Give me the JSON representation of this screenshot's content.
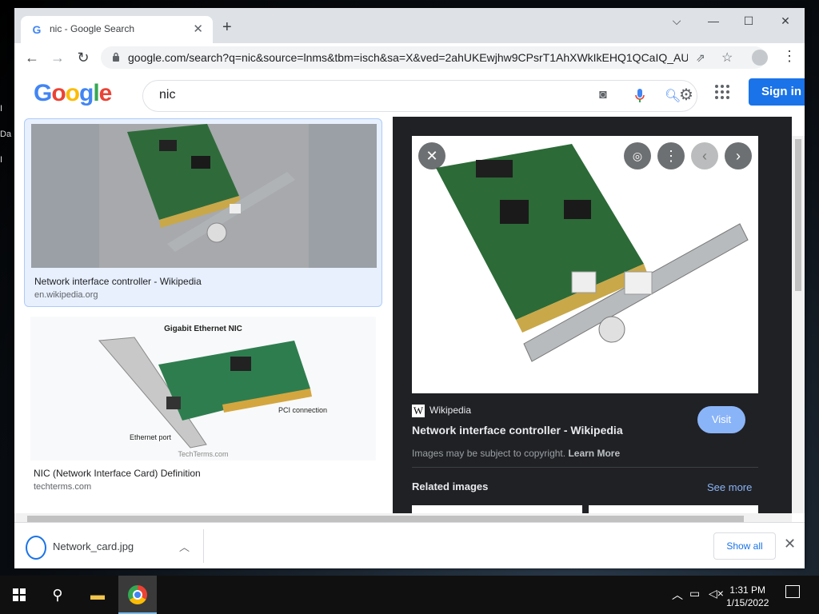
{
  "desktop": {
    "edge_labels": [
      "I",
      "Da",
      "I"
    ]
  },
  "browser": {
    "tab": {
      "title": "nic - Google Search",
      "favicon": "G"
    },
    "url": "google.com/search?q=nic&source=lnms&tbm=isch&sa=X&ved=2ahUKEwjhw9CPsrT1AhXWkIkEHQ1QCaIQ_AU...",
    "window_controls": {
      "minimize": "—",
      "maximize": "☐",
      "close": "✕",
      "tabsearch": "⌵"
    }
  },
  "google": {
    "logo": [
      "G",
      "o",
      "o",
      "g",
      "l",
      "e"
    ],
    "query": "nic",
    "signin_label": "Sign in"
  },
  "results": [
    {
      "title": "Network interface controller - Wikipedia",
      "site": "en.wikipedia.org"
    },
    {
      "title": "NIC (Network Interface Card) Definition",
      "site": "techterms.com",
      "image_text": {
        "heading": "Gigabit Ethernet NIC",
        "pci": "PCI connection",
        "port": "Ethernet port",
        "credit": "TechTerms.com"
      }
    }
  ],
  "preview": {
    "source": "Wikipedia",
    "title": "Network interface controller - Wikipedia",
    "visit_label": "Visit",
    "copyright_text": "Images may be subject to copyright.",
    "learn_more": "Learn More",
    "related_label": "Related images",
    "see_more": "See more"
  },
  "downloads": {
    "file": "Network_card.jpg",
    "show_all": "Show all"
  },
  "taskbar": {
    "time": "1:31 PM",
    "date": "1/15/2022"
  },
  "colors": {
    "accent": "#1a73e8",
    "preview_bg": "#202124",
    "visit": "#8ab4f8"
  }
}
